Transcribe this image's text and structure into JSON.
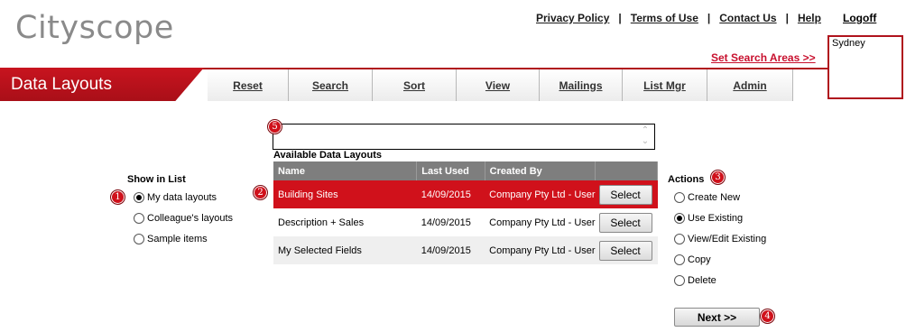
{
  "app": {
    "logo": "Cityscope"
  },
  "header": {
    "links": [
      "Privacy Policy",
      "Terms of Use",
      "Contact Us",
      "Help"
    ],
    "separator": "|",
    "logoff": "Logoff",
    "set_search_areas": "Set Search Areas >>",
    "search_area_value": "Sydney"
  },
  "banner": {
    "title": "Data Layouts"
  },
  "tabs": [
    "Reset",
    "Search",
    "Sort",
    "View",
    "Mailings",
    "List Mgr",
    "Admin"
  ],
  "layouts": {
    "heading": "Available Data Layouts",
    "columns": [
      "Name",
      "Last Used",
      "Created By",
      ""
    ],
    "rows": [
      {
        "name": "Building Sites",
        "last_used": "14/09/2015",
        "created_by": "Company Pty Ltd - User",
        "button": "Select",
        "selected": true
      },
      {
        "name": "Description + Sales",
        "last_used": "14/09/2015",
        "created_by": "Company Pty Ltd - User",
        "button": "Select",
        "selected": false
      },
      {
        "name": "My Selected Fields",
        "last_used": "14/09/2015",
        "created_by": "Company Pty Ltd - User",
        "button": "Select",
        "selected": false
      }
    ]
  },
  "show_in_list": {
    "heading": "Show in List",
    "options": [
      "My data layouts",
      "Colleague's layouts",
      "Sample items"
    ],
    "selected": "My data layouts"
  },
  "actions": {
    "heading": "Actions",
    "options": [
      "Create New",
      "Use Existing",
      "View/Edit Existing",
      "Copy",
      "Delete"
    ],
    "selected": "Use Existing",
    "next_button": "Next >>"
  },
  "badges": [
    "1",
    "2",
    "3",
    "4",
    "5"
  ],
  "colors": {
    "brand_red": "#c8102e",
    "header_grey": "#7e7e7e",
    "logo_grey": "#8a8a8a"
  }
}
